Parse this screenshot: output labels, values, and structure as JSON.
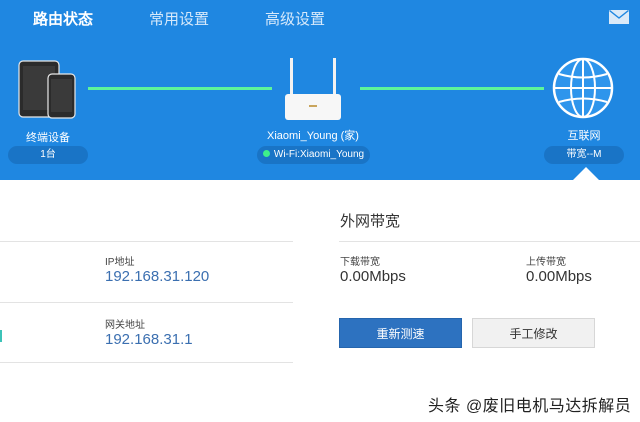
{
  "nav": {
    "tabs": [
      {
        "label": "路由状态",
        "active": true
      },
      {
        "label": "常用设置",
        "active": false
      },
      {
        "label": "高级设置",
        "active": false
      }
    ],
    "mail_icon": "envelope-icon"
  },
  "topology": {
    "devices": {
      "label": "终端设备",
      "count": "1台",
      "icon": "tablet-phone-icon"
    },
    "router": {
      "name": "Xiaomi_Young (家)",
      "wifi": "Wi-Fi:Xiaomi_Young",
      "icon": "router-icon",
      "status_color": "#3ef08a"
    },
    "internet": {
      "label": "互联网",
      "bandwidth": "带宽--M",
      "icon": "globe-icon"
    },
    "link_color": "#5df59a"
  },
  "lan_info": {
    "ip_label": "IP地址",
    "ip_value": "192.168.31.120",
    "gateway_label": "网关地址",
    "gateway_value": "192.168.31.1"
  },
  "wan_bandwidth": {
    "title": "外网带宽",
    "download_label": "下载带宽",
    "download_value": "0.00Mbps",
    "upload_label": "上传带宽",
    "upload_value": "0.00Mbps",
    "retest_button": "重新测速",
    "manual_button": "手工修改"
  },
  "watermark": "头条 @废旧电机马达拆解员",
  "colors": {
    "banner": "#1f87e1",
    "primary_button": "#2d72c0",
    "value_text": "#3b6fb0"
  }
}
